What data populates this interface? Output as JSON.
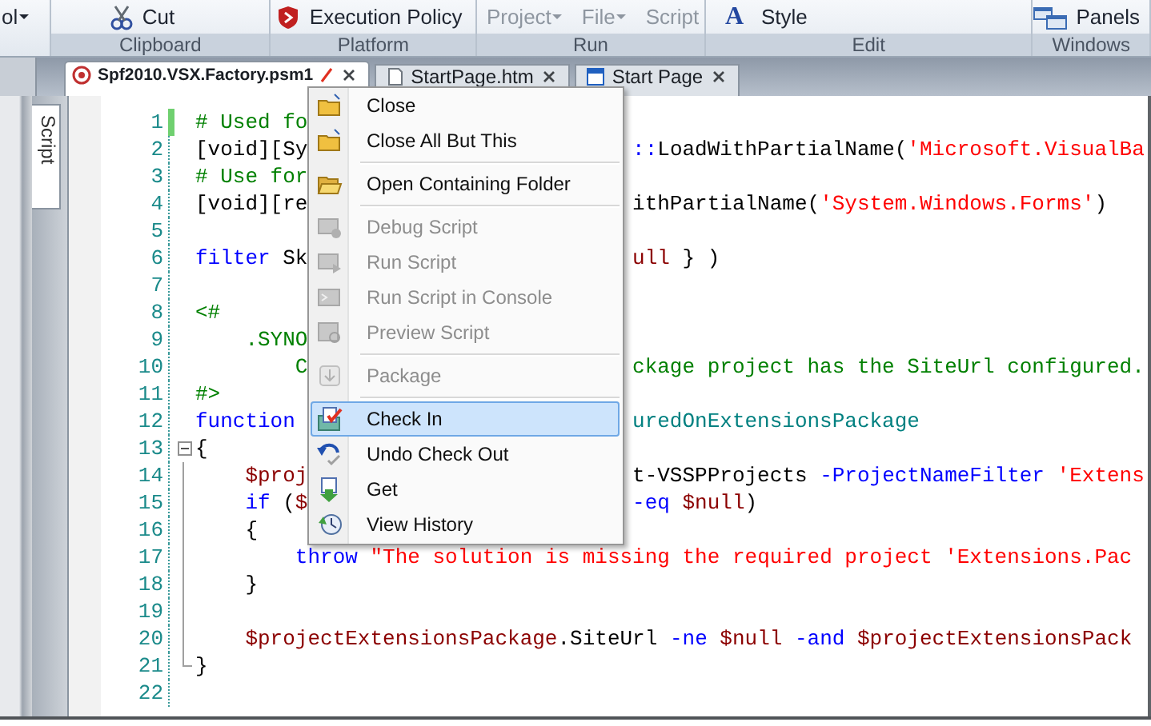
{
  "ribbon": {
    "groups": [
      {
        "buttons": [
          {
            "label": "ol",
            "dropdown": true,
            "disabled": false
          }
        ]
      },
      {
        "label": "Clipboard",
        "buttons": [
          {
            "label": "Cut",
            "dropdown": false,
            "disabled": false
          }
        ]
      },
      {
        "label": "Platform",
        "buttons": [
          {
            "label": "Execution Policy",
            "dropdown": false,
            "disabled": false
          }
        ]
      },
      {
        "label": "Run",
        "buttons": [
          {
            "label": "Project",
            "dropdown": true,
            "disabled": true
          },
          {
            "label": "File",
            "dropdown": true,
            "disabled": true
          },
          {
            "label": "Script",
            "dropdown": false,
            "disabled": true
          }
        ]
      },
      {
        "label": "Edit",
        "buttons": [
          {
            "label": "Style",
            "glyph": "A",
            "dropdown": false,
            "disabled": false
          }
        ]
      },
      {
        "label": "Windows",
        "buttons": [
          {
            "label": "Panels",
            "dropdown": false,
            "disabled": false
          }
        ]
      }
    ]
  },
  "tabs": [
    {
      "label": "Spf2010.VSX.Factory.psm1",
      "selected": true,
      "modified": true
    },
    {
      "label": "StartPage.htm",
      "selected": false,
      "modified": false
    },
    {
      "label": "Start Page",
      "selected": false,
      "modified": false
    }
  ],
  "side_tabs": [
    {
      "label": "Script",
      "selected": true
    }
  ],
  "editor": {
    "lines": [
      {
        "number": "1",
        "changed": true,
        "left": [
          {
            "text": "# Used fo",
            "kind": "comment"
          }
        ]
      },
      {
        "number": "2",
        "changed": false,
        "left": [
          {
            "text": "[void][Sy",
            "kind": "plain"
          }
        ],
        "right": [
          {
            "text": "::",
            "kind": "keyword"
          },
          {
            "text": "LoadWithPartialName(",
            "kind": "plain"
          },
          {
            "text": "'Microsoft.VisualBa",
            "kind": "string"
          }
        ]
      },
      {
        "number": "3",
        "changed": false,
        "left": [
          {
            "text": "# Use for",
            "kind": "comment"
          }
        ]
      },
      {
        "number": "4",
        "changed": false,
        "left": [
          {
            "text": "[void][re",
            "kind": "plain"
          }
        ],
        "right": [
          {
            "text": "ithPartialName(",
            "kind": "plain"
          },
          {
            "text": "'System.Windows.Forms'",
            "kind": "string"
          },
          {
            "text": ")",
            "kind": "plain"
          }
        ]
      },
      {
        "number": "5",
        "changed": false
      },
      {
        "number": "6",
        "changed": false,
        "left": [
          {
            "text": "filter",
            "kind": "keyword"
          },
          {
            "text": " Sk",
            "kind": "plain"
          }
        ],
        "right": [
          {
            "text": "ull",
            "kind": "variable"
          },
          {
            "text": " } )",
            "kind": "plain"
          }
        ]
      },
      {
        "number": "7",
        "changed": false
      },
      {
        "number": "8",
        "changed": false,
        "left": [
          {
            "text": "<#",
            "kind": "comment"
          }
        ]
      },
      {
        "number": "9",
        "changed": false,
        "left": [
          {
            "text": "    .SYNO",
            "kind": "comment"
          }
        ]
      },
      {
        "number": "10",
        "changed": false,
        "left": [
          {
            "text": "        C",
            "kind": "comment"
          }
        ],
        "right": [
          {
            "text": "ckage project has the SiteUrl configured.",
            "kind": "comment"
          }
        ]
      },
      {
        "number": "11",
        "changed": false,
        "left": [
          {
            "text": "#>",
            "kind": "comment"
          }
        ]
      },
      {
        "number": "12",
        "changed": false,
        "left": [
          {
            "text": "function ",
            "kind": "keyword"
          }
        ],
        "right": [
          {
            "text": "uredOnExtensionsPackage",
            "kind": "name"
          }
        ]
      },
      {
        "number": "13",
        "changed": false,
        "expanded": true,
        "left": [
          {
            "text": "{",
            "kind": "plain"
          }
        ],
        "children": [
          {
            "number": "14",
            "changed": false,
            "left": [
              {
                "text": "    $proj",
                "kind": "variable"
              }
            ],
            "right": [
              {
                "text": "t-VSSPProjects ",
                "kind": "plain"
              },
              {
                "text": "-ProjectNameFilter",
                "kind": "keyword"
              },
              {
                "text": " 'Extens",
                "kind": "string"
              }
            ]
          },
          {
            "number": "15",
            "changed": false,
            "left": [
              {
                "text": "    if",
                "kind": "keyword"
              },
              {
                "text": " (",
                "kind": "plain"
              },
              {
                "text": "$",
                "kind": "variable"
              }
            ],
            "right": [
              {
                "text": "-eq",
                "kind": "keyword"
              },
              {
                "text": " $null",
                "kind": "variable"
              },
              {
                "text": ")",
                "kind": "plain"
              }
            ]
          },
          {
            "number": "16",
            "changed": false,
            "left": [
              {
                "text": "    {",
                "kind": "plain"
              }
            ]
          },
          {
            "number": "17",
            "changed": false,
            "left": [
              {
                "text": "        throw",
                "kind": "keyword"
              },
              {
                "text": " \"The solution is missing the required project 'Extensions.Pac",
                "kind": "string"
              }
            ]
          },
          {
            "number": "18",
            "changed": false,
            "left": [
              {
                "text": "    }",
                "kind": "plain"
              }
            ]
          },
          {
            "number": "19",
            "changed": false
          },
          {
            "number": "20",
            "changed": false,
            "left": [
              {
                "text": "    $projectExtensionsPackage",
                "kind": "variable"
              },
              {
                "text": ".SiteUrl ",
                "kind": "plain"
              },
              {
                "text": "-ne",
                "kind": "keyword"
              },
              {
                "text": " $null ",
                "kind": "variable"
              },
              {
                "text": "-and",
                "kind": "keyword"
              },
              {
                "text": " $projectExtensionsPack",
                "kind": "variable"
              }
            ]
          },
          {
            "number": "21",
            "changed": false,
            "left": [
              {
                "text": "}",
                "kind": "plain"
              }
            ]
          }
        ]
      },
      {
        "number": "22",
        "changed": false
      }
    ]
  },
  "context_menu": {
    "items": [
      {
        "kind": "item",
        "label": "Close",
        "disabled": false,
        "selected": false
      },
      {
        "kind": "item",
        "label": "Close All But This",
        "disabled": false,
        "selected": false
      },
      {
        "kind": "separator"
      },
      {
        "kind": "item",
        "label": "Open Containing Folder",
        "disabled": false,
        "selected": false
      },
      {
        "kind": "separator"
      },
      {
        "kind": "item",
        "label": "Debug Script",
        "disabled": true,
        "selected": false
      },
      {
        "kind": "item",
        "label": "Run Script",
        "disabled": true,
        "selected": false
      },
      {
        "kind": "item",
        "label": "Run Script in Console",
        "disabled": true,
        "selected": false
      },
      {
        "kind": "item",
        "label": "Preview Script",
        "disabled": true,
        "selected": false
      },
      {
        "kind": "separator"
      },
      {
        "kind": "item",
        "label": "Package",
        "disabled": true,
        "selected": false
      },
      {
        "kind": "separator"
      },
      {
        "kind": "item",
        "label": "Check In",
        "disabled": false,
        "selected": true
      },
      {
        "kind": "item",
        "label": "Undo Check Out",
        "disabled": false,
        "selected": false
      },
      {
        "kind": "item",
        "label": "Get",
        "disabled": false,
        "selected": false
      },
      {
        "kind": "item",
        "label": "View History",
        "disabled": false,
        "selected": false
      }
    ]
  }
}
